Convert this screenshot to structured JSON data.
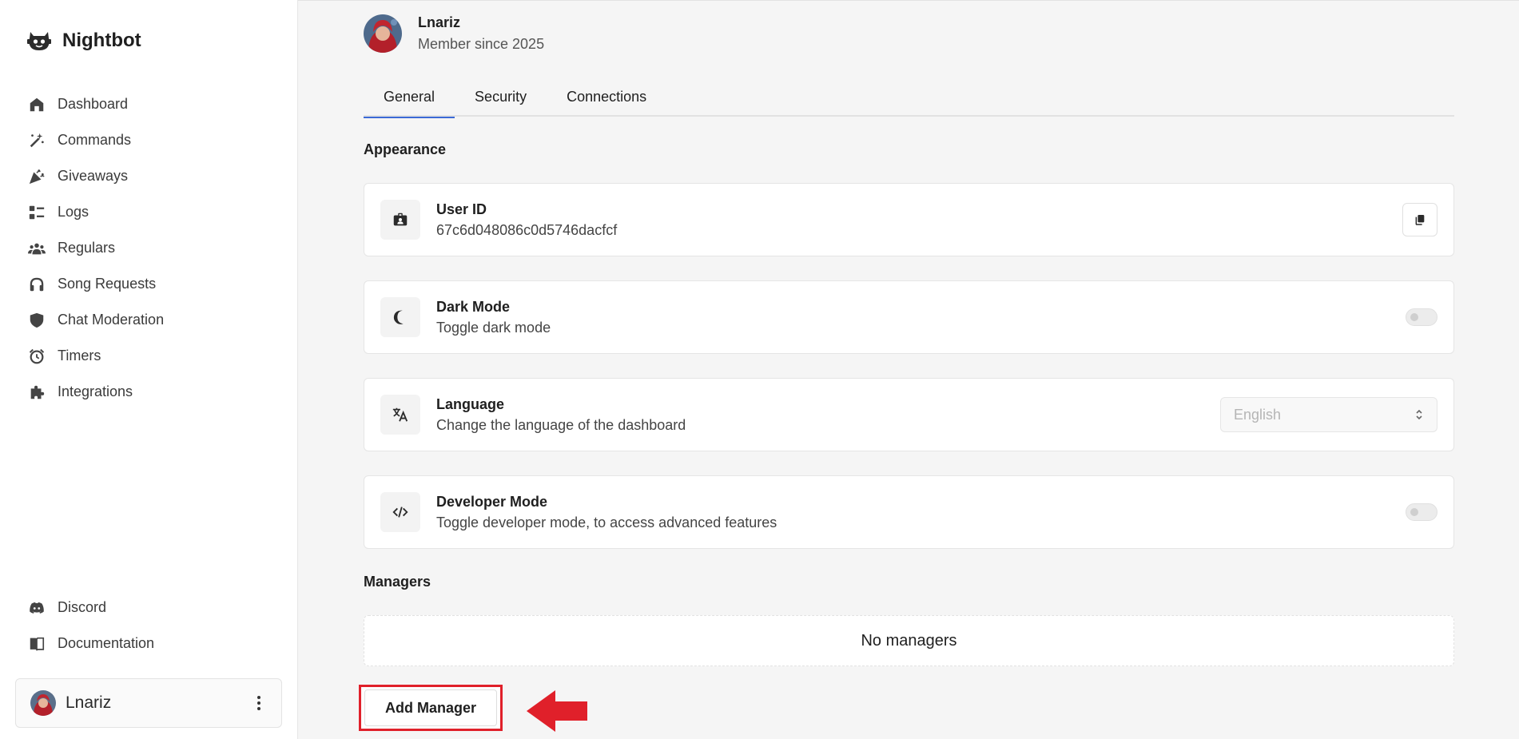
{
  "app": {
    "name": "Nightbot"
  },
  "sidebar": {
    "items": [
      {
        "label": "Dashboard",
        "icon": "home-icon"
      },
      {
        "label": "Commands",
        "icon": "magic-wand-icon"
      },
      {
        "label": "Giveaways",
        "icon": "party-popper-icon"
      },
      {
        "label": "Logs",
        "icon": "list-icon"
      },
      {
        "label": "Regulars",
        "icon": "users-icon"
      },
      {
        "label": "Song Requests",
        "icon": "headphones-icon"
      },
      {
        "label": "Chat Moderation",
        "icon": "shield-icon"
      },
      {
        "label": "Timers",
        "icon": "alarm-clock-icon"
      },
      {
        "label": "Integrations",
        "icon": "puzzle-icon"
      }
    ],
    "bottom_items": [
      {
        "label": "Discord",
        "icon": "discord-icon"
      },
      {
        "label": "Documentation",
        "icon": "book-icon"
      }
    ],
    "user": {
      "name": "Lnariz"
    }
  },
  "profile": {
    "name": "Lnariz",
    "member_since": "Member since 2025"
  },
  "tabs": [
    {
      "label": "General",
      "active": true
    },
    {
      "label": "Security",
      "active": false
    },
    {
      "label": "Connections",
      "active": false
    }
  ],
  "appearance": {
    "title": "Appearance",
    "user_id": {
      "title": "User ID",
      "value": "67c6d048086c0d5746dacfcf"
    },
    "dark_mode": {
      "title": "Dark Mode",
      "desc": "Toggle dark mode",
      "enabled": false
    },
    "language": {
      "title": "Language",
      "desc": "Change the language of the dashboard",
      "value": "English"
    },
    "developer_mode": {
      "title": "Developer Mode",
      "desc": "Toggle developer mode, to access advanced features",
      "enabled": false
    }
  },
  "managers": {
    "title": "Managers",
    "empty_text": "No managers",
    "add_label": "Add Manager"
  },
  "colors": {
    "accent": "#3b6ad6",
    "highlight": "#e0202a"
  }
}
